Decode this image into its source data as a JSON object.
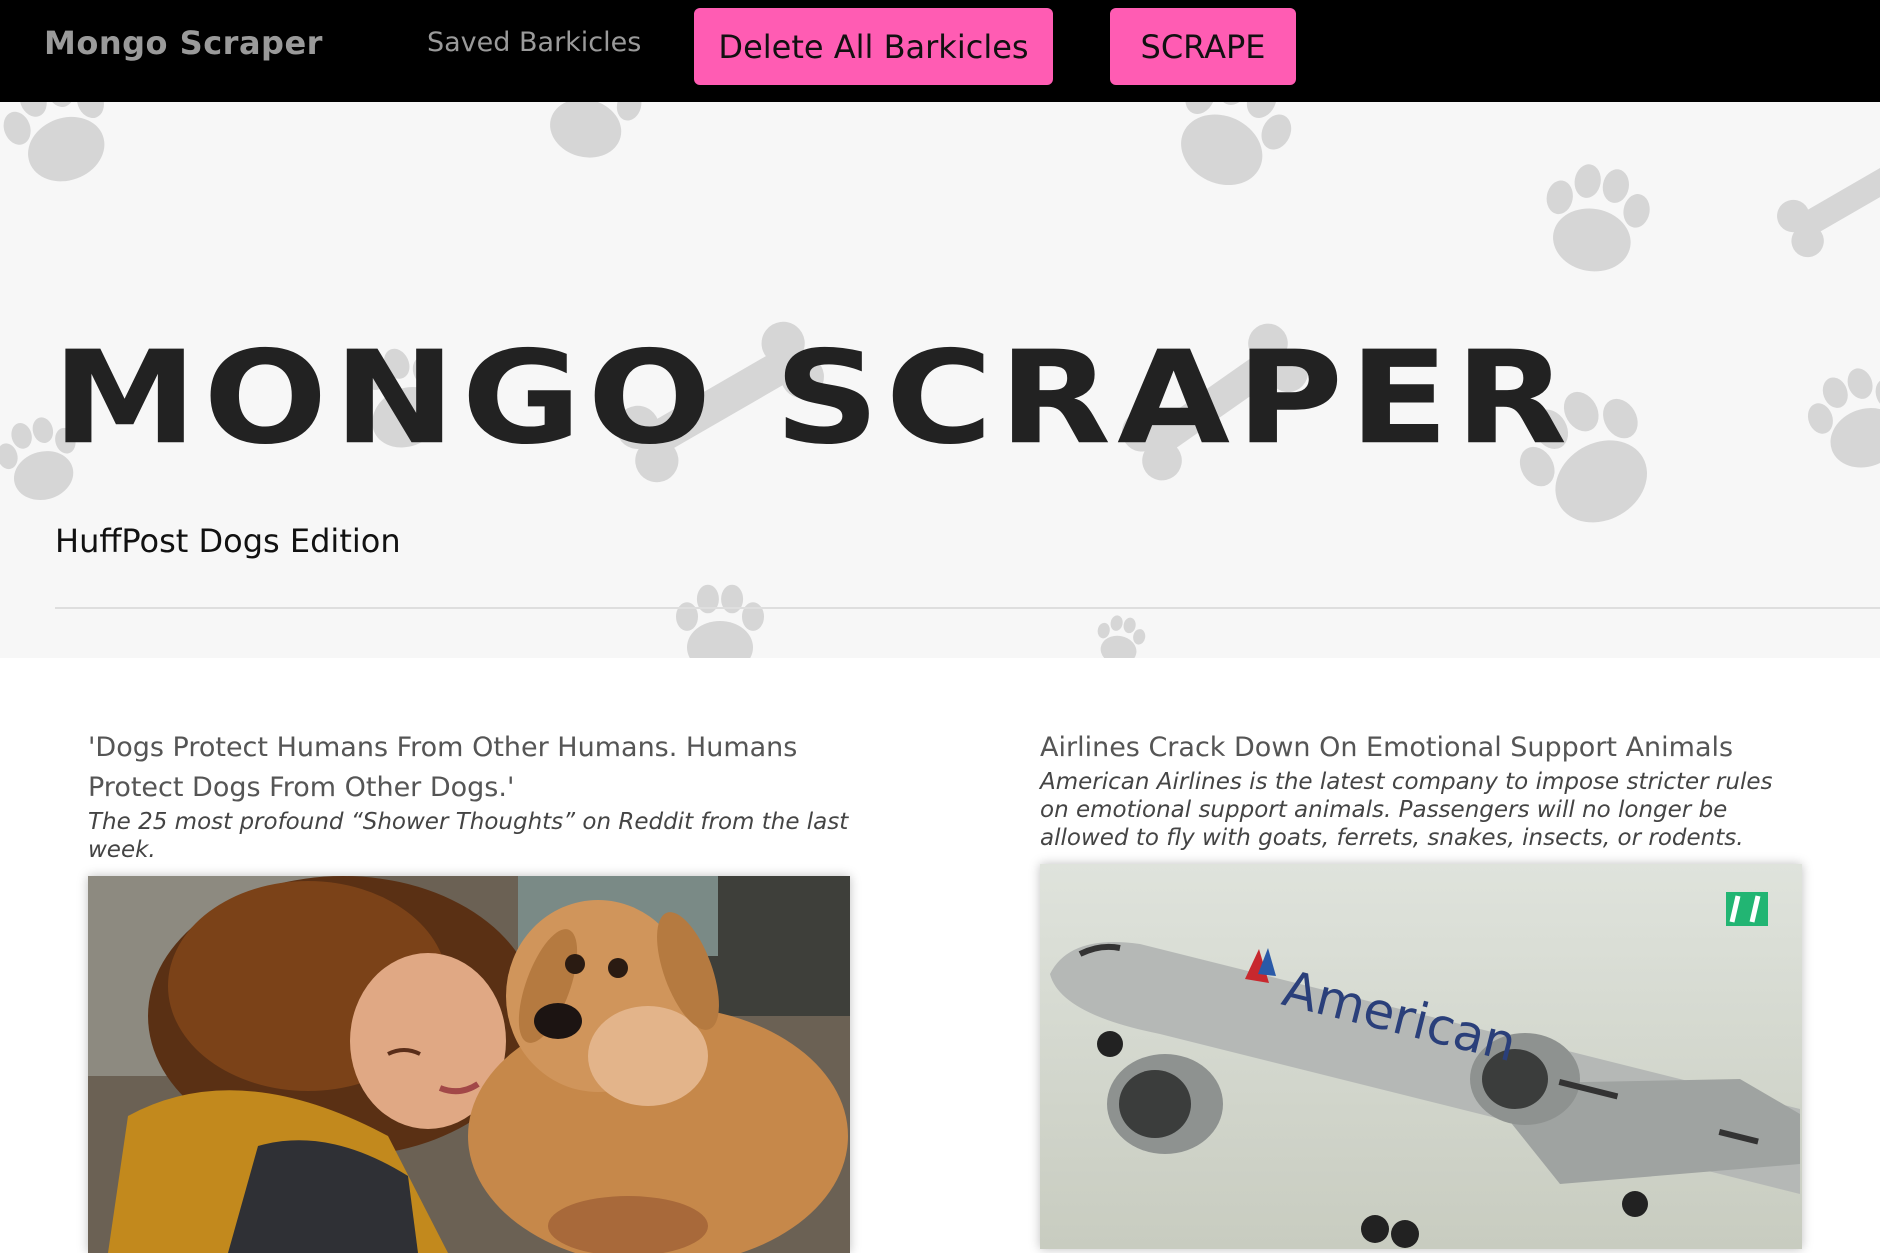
{
  "navbar": {
    "brand": "Mongo Scraper",
    "saved_link": "Saved Barkicles",
    "delete_button": "Delete All Barkicles",
    "scrape_button": "SCRAPE",
    "button_color": "#ff5cb3"
  },
  "hero": {
    "title": "MONGO SCRAPER",
    "subtitle": "HuffPost Dogs Edition"
  },
  "articles": [
    {
      "title": "'Dogs Protect Humans From Other Humans. Humans Protect Dogs From Other Dogs.'",
      "summary": "The 25 most profound “Shower Thoughts” on Reddit from the last week.",
      "image": "woman-with-golden-retriever"
    },
    {
      "title": "Airlines Crack Down On Emotional Support Animals",
      "summary": "American Airlines is the latest company to impose stricter rules on emotional support animals. Passengers will no longer be allowed to fly with goats, ferrets, snakes, insects, or rodents.",
      "image": "american-airlines-plane",
      "image_text": "American"
    }
  ]
}
